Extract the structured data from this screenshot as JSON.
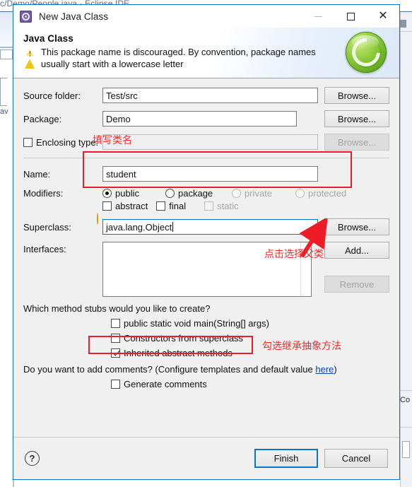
{
  "background": {
    "ide_title": "c/Demo/People.java - Eclipse IDE",
    "right_edge_text": "Co"
  },
  "dialog": {
    "titlebar": {
      "icon": "new-java-class-icon",
      "title": "New Java Class",
      "minimize_glyph": "–",
      "maximize_glyph": "□",
      "close_glyph": "✕"
    },
    "header": {
      "heading": "Java Class",
      "status_icon": "warning-icon",
      "message": "This package name is discouraged. By convention, package names usually start with a lowercase letter",
      "logo": "green-c-logo"
    },
    "form": {
      "source_folder": {
        "label": "Source folder:",
        "value": "Test/src",
        "browse": "Browse..."
      },
      "package": {
        "label": "Package:",
        "value": "Demo",
        "browse": "Browse..."
      },
      "enclosing_type": {
        "label": "Enclosing type:",
        "checked": false,
        "value": "",
        "browse": "Browse...",
        "disabled": true
      },
      "name": {
        "label": "Name:",
        "value": "student"
      },
      "modifiers": {
        "label": "Modifiers:",
        "radios": [
          {
            "label": "public",
            "selected": true,
            "disabled": false
          },
          {
            "label": "package",
            "selected": false,
            "disabled": false
          },
          {
            "label": "private",
            "selected": false,
            "disabled": true
          },
          {
            "label": "protected",
            "selected": false,
            "disabled": true
          }
        ],
        "checkboxes": [
          {
            "label": "abstract",
            "checked": false,
            "disabled": false
          },
          {
            "label": "final",
            "checked": false,
            "disabled": false
          },
          {
            "label": "static",
            "checked": false,
            "disabled": true
          }
        ]
      },
      "superclass": {
        "label": "Superclass:",
        "value": "java.lang.Object",
        "browse": "Browse...",
        "focused": true,
        "hint_icon": "lightbulb-icon"
      },
      "interfaces": {
        "label": "Interfaces:",
        "items": [],
        "add": "Add...",
        "remove": "Remove",
        "remove_disabled": true
      },
      "method_stubs": {
        "question": "Which method stubs would you like to create?",
        "options": [
          {
            "label": "public static void main(String[] args)",
            "checked": false
          },
          {
            "label": "Constructors from superclass",
            "checked": false
          },
          {
            "label": "Inherited abstract methods",
            "checked": true
          }
        ]
      },
      "comments": {
        "question_prefix": "Do you want to add comments? (Configure templates and default value ",
        "link": "here",
        "question_suffix": ")",
        "option": {
          "label": "Generate comments",
          "checked": false
        }
      }
    },
    "footer": {
      "help": "?",
      "finish": "Finish",
      "cancel": "Cancel"
    }
  },
  "annotations": [
    {
      "id": "fill-class-name",
      "text": "填写类名"
    },
    {
      "id": "click-select-superclass",
      "text": "点击选择父类"
    },
    {
      "id": "check-inherited-abstract",
      "text": "勾选继承抽象方法"
    }
  ],
  "colors": {
    "annotation_red": "#ee1c25",
    "accent_blue": "#0a74c8",
    "dialog_bg": "#f0f0f0"
  }
}
